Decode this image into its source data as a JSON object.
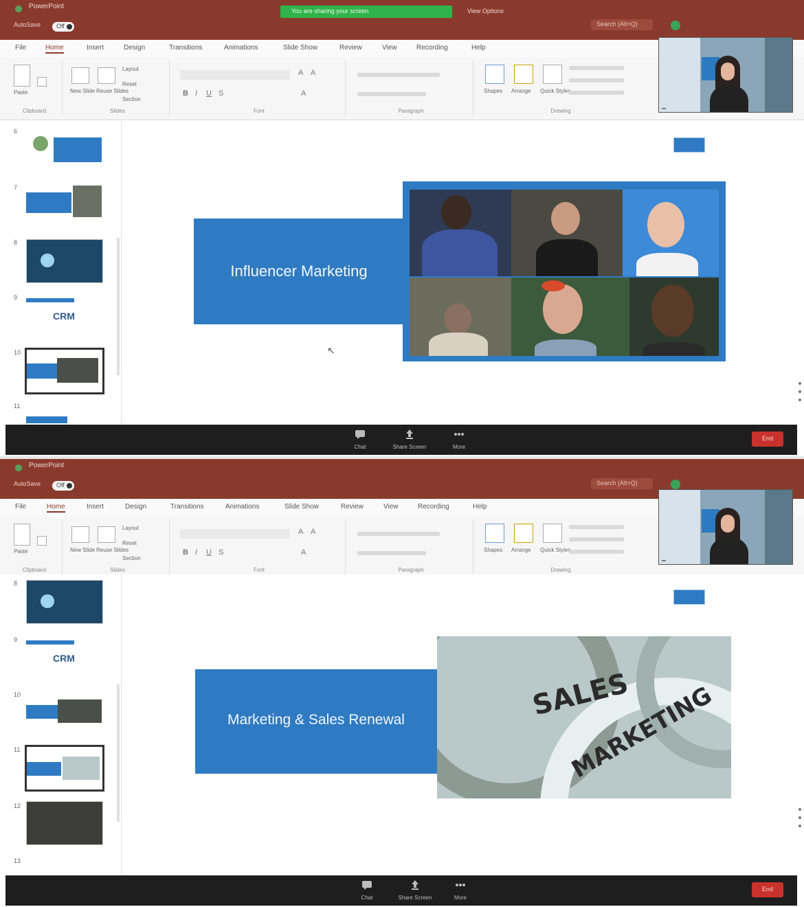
{
  "titlebar": {
    "app_name": "PowerPoint",
    "autosave_label": "AutoSave",
    "autosave_state": "Off",
    "document_title": "",
    "search_placeholder": "Search (Alt+Q)"
  },
  "share_banner": {
    "text": "You are sharing your screen",
    "view_options": "View Options"
  },
  "ribbon": {
    "tabs": [
      "File",
      "Home",
      "Insert",
      "Design",
      "Transitions",
      "Animations",
      "Slide Show",
      "Review",
      "View",
      "Recording",
      "Help"
    ],
    "groups": {
      "clipboard": {
        "label": "Clipboard",
        "paste": "Paste"
      },
      "slides": {
        "label": "Slides",
        "new_slide": "New Slide",
        "reuse": "Reuse Slides",
        "layout": "Layout",
        "reset": "Reset",
        "section": "Section"
      },
      "font": {
        "label": "Font"
      },
      "paragraph": {
        "label": "Paragraph"
      },
      "drawing": {
        "label": "Drawing",
        "shapes": "Shapes",
        "arrange": "Arrange",
        "quick_styles": "Quick Styles"
      }
    }
  },
  "webcam": {
    "participant_name": ""
  },
  "screens": [
    {
      "thumbnails": [
        {
          "num": "6"
        },
        {
          "num": "7"
        },
        {
          "num": "8"
        },
        {
          "num": "9",
          "text": "CRM"
        },
        {
          "num": "10"
        },
        {
          "num": "11"
        }
      ],
      "selected_slide": "10",
      "slide": {
        "title": "Influencer Marketing",
        "footer": ""
      },
      "toolbar": {
        "left": "",
        "buttons": [
          "Chat",
          "Share Screen",
          "More"
        ],
        "end": "End"
      }
    },
    {
      "thumbnails": [
        {
          "num": "8"
        },
        {
          "num": "9",
          "text": "CRM"
        },
        {
          "num": "10"
        },
        {
          "num": "11"
        },
        {
          "num": "12"
        },
        {
          "num": "13"
        }
      ],
      "selected_slide": "11",
      "slide": {
        "title": "Marketing & Sales Renewal",
        "footer": "",
        "image_words": [
          "SALES",
          "MARKETING"
        ]
      },
      "toolbar": {
        "left": "",
        "buttons": [
          "Chat",
          "Share Screen",
          "More"
        ],
        "end": "End"
      }
    }
  ]
}
